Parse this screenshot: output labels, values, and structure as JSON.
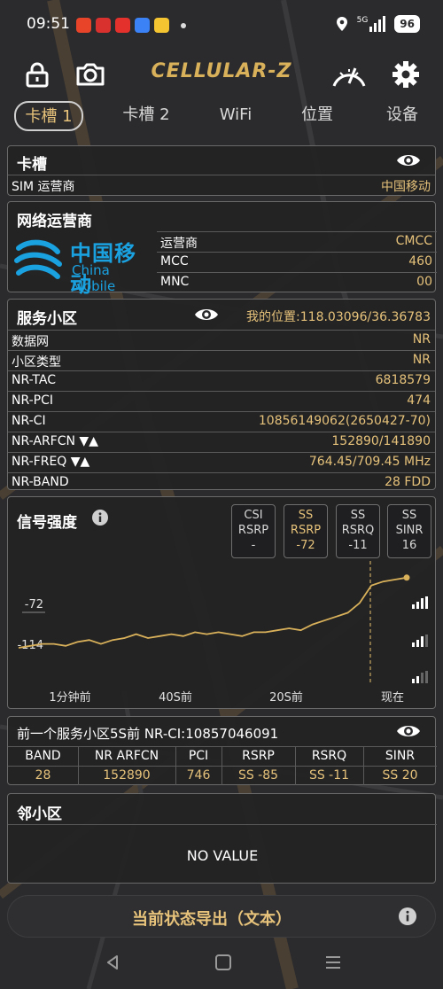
{
  "status": {
    "time": "09:51",
    "network": "5G",
    "battery": "96"
  },
  "app": {
    "brand": "CELLULAR-Z"
  },
  "tabs": [
    "卡槽 1",
    "卡槽 2",
    "WiFi",
    "位置",
    "设备"
  ],
  "slot": {
    "title": "卡槽",
    "sim_label": "SIM 运营商",
    "sim_value": "中国移动"
  },
  "operator": {
    "title": "网络运营商",
    "logo_cn": "中国移动",
    "logo_en": "China Mobile",
    "rows": [
      {
        "k": "运营商",
        "v": "CMCC"
      },
      {
        "k": "MCC",
        "v": "460"
      },
      {
        "k": "MNC",
        "v": "00"
      }
    ]
  },
  "serving": {
    "title": "服务小区",
    "location": "我的位置:118.03096/36.36783",
    "rows": [
      {
        "k": "数据网",
        "v": "NR"
      },
      {
        "k": "小区类型",
        "v": "NR"
      },
      {
        "k": "NR-TAC",
        "v": "6818579"
      },
      {
        "k": "NR-PCI",
        "v": "474"
      },
      {
        "k": "NR-CI",
        "v": "10856149062(2650427-70)"
      },
      {
        "k": "NR-ARFCN ▼▲",
        "v": "152890/141890"
      },
      {
        "k": "NR-FREQ ▼▲",
        "v": "764.45/709.45 MHz"
      },
      {
        "k": "NR-BAND",
        "v": "28 FDD"
      }
    ]
  },
  "signal": {
    "title": "信号强度",
    "boxes": [
      {
        "l1": "CSI",
        "l2": "RSRP",
        "l3": "-",
        "highlight": false
      },
      {
        "l1": "SS",
        "l2": "RSRP",
        "l3": "-72",
        "highlight": true
      },
      {
        "l1": "SS",
        "l2": "RSRQ",
        "l3": "-11",
        "highlight": false
      },
      {
        "l1": "SS",
        "l2": "SINR",
        "l3": "16",
        "highlight": false
      }
    ],
    "chart_data": {
      "type": "line",
      "series": [
        {
          "values": [
            -108,
            -107,
            -106,
            -106,
            -107,
            -105,
            -104,
            -106,
            -104,
            -103,
            -101,
            -103,
            -102,
            -101,
            -102,
            -100,
            -101,
            -100,
            -101,
            -102,
            -100,
            -100,
            -99,
            -98,
            -99,
            -96,
            -94,
            -92,
            -90,
            -85,
            -76,
            -74,
            -73,
            -72
          ]
        }
      ],
      "yticks": [
        "-72",
        "-114"
      ],
      "ylim": [
        -118,
        -68
      ],
      "xticks": [
        "1分钟前",
        "40S前",
        "20S前",
        "现在"
      ],
      "line_color": "#d9b15a",
      "marker_color": "#d9b15a"
    }
  },
  "prev": {
    "title": "前一个服务小区5S前 NR-CI:10857046091",
    "headers": [
      "BAND",
      "NR ARFCN",
      "PCI",
      "RSRP",
      "RSRQ",
      "SINR"
    ],
    "values": [
      "28",
      "152890",
      "746",
      "SS -85",
      "SS -11",
      "SS 20"
    ]
  },
  "neighbor": {
    "title": "邻小区",
    "empty": "NO VALUE"
  },
  "export": {
    "label": "当前状态导出（文本）"
  },
  "colors": {
    "accent": "#e6c27a",
    "brand": "#d9b15a",
    "background": "#2a2a2c"
  }
}
